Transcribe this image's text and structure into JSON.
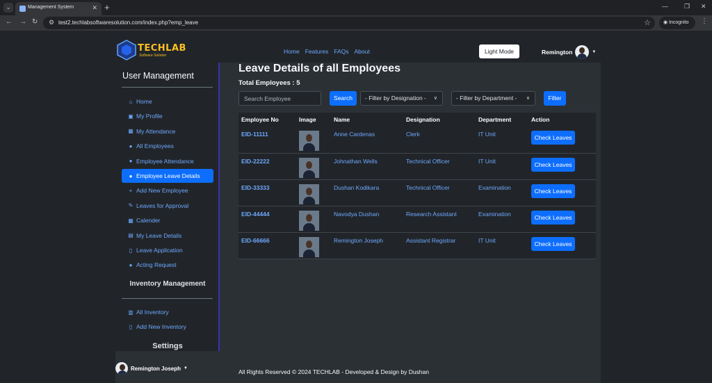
{
  "browser": {
    "tab_title": "Management System",
    "url": "test2.techlabsoftwaresolution.com/index.php?emp_leave",
    "incognito_label": "Incognito"
  },
  "brand": {
    "name": "TECHLAB",
    "tagline": "Software Solution"
  },
  "nav": {
    "links": [
      "Home",
      "Features",
      "FAQs",
      "About"
    ],
    "light_mode": "Light Mode",
    "user": "Remington"
  },
  "sidebar": {
    "title": "User Management",
    "items": [
      {
        "label": "Home",
        "icon": "home-icon",
        "glyph": "⌂"
      },
      {
        "label": "My Profile",
        "icon": "id-card-icon",
        "glyph": "▣"
      },
      {
        "label": "My Attendance",
        "icon": "calendar-icon",
        "glyph": "▦"
      },
      {
        "label": "All Employees",
        "icon": "user-icon",
        "glyph": "●"
      },
      {
        "label": "Employee Attendance",
        "icon": "user-icon",
        "glyph": "●"
      },
      {
        "label": "Employee Leave Details",
        "icon": "user-icon",
        "glyph": "●"
      },
      {
        "label": "Add New Employee",
        "icon": "user-plus-icon",
        "glyph": "+"
      },
      {
        "label": "Leaves for Approval",
        "icon": "edit-icon",
        "glyph": "✎"
      },
      {
        "label": "Calender",
        "icon": "calendar-icon",
        "glyph": "▦"
      },
      {
        "label": "My Leave Details",
        "icon": "table-icon",
        "glyph": "▤"
      },
      {
        "label": "Leave Application",
        "icon": "file-icon",
        "glyph": "▯"
      },
      {
        "label": "Acting Request",
        "icon": "user-gear-icon",
        "glyph": "●"
      }
    ],
    "inventory_title": "Inventory Management",
    "inventory_items": [
      {
        "label": "All Inventory",
        "icon": "building-icon",
        "glyph": "▥"
      },
      {
        "label": "Add New Inventory",
        "icon": "file-plus-icon",
        "glyph": "▯"
      }
    ],
    "settings_title": "Settings",
    "user": "Remington Joseph"
  },
  "main": {
    "title": "Leave Details of all Employees",
    "total": "Total Employees : 5",
    "search_placeholder": "Search Employee",
    "search_button": "Search",
    "designation_filter": "- Filter by Designation -",
    "department_filter": "- Filter by Department -",
    "filter_button": "Filter",
    "columns": [
      "Employee No",
      "Image",
      "Name",
      "Designation",
      "Department",
      "Action"
    ],
    "rows": [
      {
        "emp_no": "EID-11111",
        "name": "Anne Cardenas",
        "designation": "Clerk",
        "department": "IT Unit",
        "action": "Check Leaves"
      },
      {
        "emp_no": "EID-22222",
        "name": "Johnathan Wells",
        "designation": "Technical Officer",
        "department": "IT Unit",
        "action": "Check Leaves"
      },
      {
        "emp_no": "EID-33333",
        "name": "Dushan Kodikara",
        "designation": "Technical Officer",
        "department": "Examination",
        "action": "Check Leaves"
      },
      {
        "emp_no": "EID-44444",
        "name": "Navodya Dushan",
        "designation": "Research Assistant",
        "department": "Examination",
        "action": "Check Leaves"
      },
      {
        "emp_no": "EID-66666",
        "name": "Remington Joseph",
        "designation": "Assistant Registrar",
        "department": "IT Unit",
        "action": "Check Leaves"
      }
    ]
  },
  "footer": "All Rights Reserved © 2024 TECHLAB - Developed & Design by Dushan",
  "colors": {
    "primary": "#0d6efd",
    "link": "#6ea8fe",
    "brand": "#fbbf24"
  }
}
